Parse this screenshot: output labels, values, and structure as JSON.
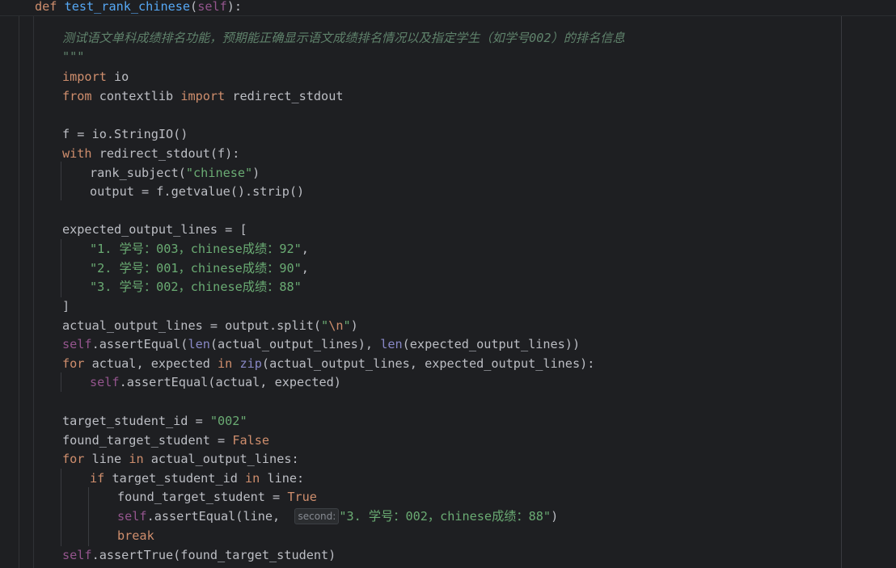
{
  "editor": {
    "sticky_header": {
      "kw_def": "def",
      "fn_name": "test_rank_chinese",
      "open": "(",
      "param": "self",
      "close": "):"
    },
    "lines": {
      "doc_open": "\"\"\"",
      "doc_text": "测试语文单科成绩排名功能，预期能正确显示语文成绩排名情况以及指定学生（如学号002）的排名信息",
      "doc_close": "\"\"\"",
      "l_import_kw": "import",
      "l_import_rest": " io",
      "l_from_kw": "from",
      "l_from_mid": " contextlib ",
      "l_from_import_kw": "import",
      "l_from_rest": " redirect_stdout",
      "l_f": "f = io.StringIO()",
      "l_with_kw": "with",
      "l_with_rest": " redirect_stdout(f):",
      "l_rank_call": "rank_subject(",
      "l_rank_arg": "\"chinese\"",
      "l_rank_close": ")",
      "l_output": "output = f.getvalue().strip()",
      "l_expected_open": "expected_output_lines = [",
      "l_exp1": "\"1. 学号：003，chinese成绩：92\"",
      "l_exp1_comma": ",",
      "l_exp2": "\"2. 学号：001，chinese成绩：90\"",
      "l_exp2_comma": ",",
      "l_exp3": "\"3. 学号：002，chinese成绩：88\"",
      "l_expected_close": "]",
      "l_actual_a": "actual_output_lines = output.split(",
      "l_actual_q1": "\"",
      "l_actual_esc": "\\n",
      "l_actual_q2": "\"",
      "l_actual_b": ")",
      "l_assert1_self": "self",
      "l_assert1_a": ".assertEqual(",
      "l_assert1_len1": "len",
      "l_assert1_b": "(actual_output_lines), ",
      "l_assert1_len2": "len",
      "l_assert1_c": "(expected_output_lines))",
      "l_for1_kw": "for",
      "l_for1_a": " actual, expected ",
      "l_for1_in": "in",
      "l_for1_sp": " ",
      "l_for1_zip": "zip",
      "l_for1_b": "(actual_output_lines, expected_output_lines):",
      "l_assert2_self": "self",
      "l_assert2_rest": ".assertEqual(actual, expected)",
      "l_target_a": "target_student_id = ",
      "l_target_str": "\"002\"",
      "l_found_a": "found_target_student = ",
      "l_found_false": "False",
      "l_for2_kw": "for",
      "l_for2_a": " line ",
      "l_for2_in": "in",
      "l_for2_b": " actual_output_lines:",
      "l_if_kw": "if",
      "l_if_a": " target_student_id ",
      "l_if_in": "in",
      "l_if_b": " line:",
      "l_found2_a": "found_target_student = ",
      "l_found2_true": "True",
      "l_assert3_self": "self",
      "l_assert3_a": ".assertEqual(line, ",
      "l_assert3_hint": "second:",
      "l_assert3_str": "\"3. 学号：002，chinese成绩：88\"",
      "l_assert3_close": ")",
      "l_break": "break",
      "l_assert4_self": "self",
      "l_assert4_rest": ".assertTrue(found_target_student)"
    }
  }
}
